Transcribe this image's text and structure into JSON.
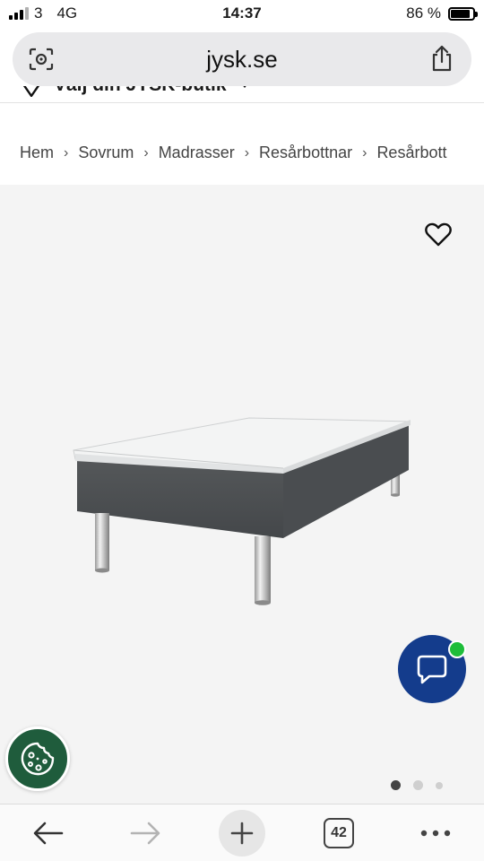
{
  "status": {
    "carrier": "3",
    "network": "4G",
    "time": "14:37",
    "battery_percent": "86 %",
    "battery_level": 0.86,
    "signal_bars": 3
  },
  "browser": {
    "url": "jysk.se",
    "tabs_count": "42"
  },
  "store_selector": {
    "label": "Välj din JYSK-butik"
  },
  "breadcrumb": [
    "Hem",
    "Sovrum",
    "Madrasser",
    "Resårbottnar",
    "Resårbott"
  ],
  "gallery": {
    "current": 1,
    "total": 3
  },
  "colors": {
    "chat_button": "#143c8c",
    "chat_online": "#1ebd3a",
    "cookie_button": "#1f5c3c"
  }
}
